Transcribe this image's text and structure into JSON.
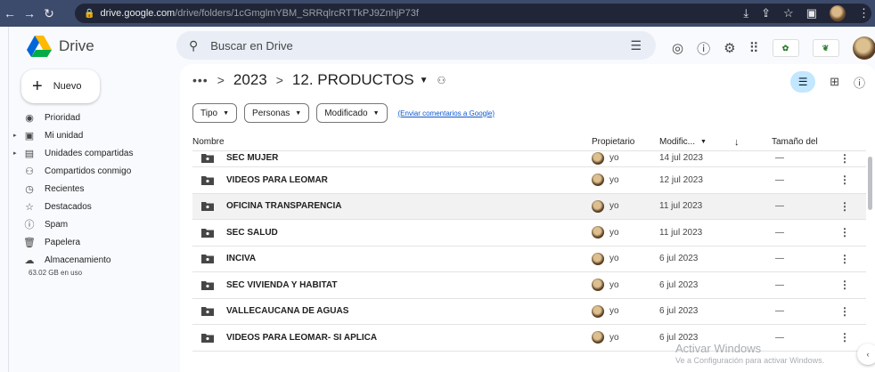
{
  "browser": {
    "url_domain": "drive.google.com",
    "url_path": "/drive/folders/1cGmglmYBM_SRRqlrcRTTkPJ9ZnhjP73f"
  },
  "app": {
    "title": "Drive",
    "search_placeholder": "Buscar en Drive",
    "new_label": "Nuevo"
  },
  "nav": {
    "items": [
      {
        "label": "Prioridad",
        "icon": "checkcircle-icon"
      },
      {
        "label": "Mi unidad",
        "icon": "drive-icon"
      },
      {
        "label": "Unidades compartidas",
        "icon": "shared-drives-icon"
      },
      {
        "label": "Compartidos conmigo",
        "icon": "people-icon"
      },
      {
        "label": "Recientes",
        "icon": "clock-icon"
      },
      {
        "label": "Destacados",
        "icon": "star-icon"
      },
      {
        "label": "Spam",
        "icon": "spam-icon"
      },
      {
        "label": "Papelera",
        "icon": "trash-icon"
      },
      {
        "label": "Almacenamiento",
        "icon": "cloud-icon"
      }
    ],
    "storage_text": "63.02 GB en uso"
  },
  "breadcrumb": {
    "more": "•••",
    "sep": ">",
    "parent": "2023",
    "current": "12. PRODUCTOS"
  },
  "filters": {
    "chips": [
      "Tipo",
      "Personas",
      "Modificado"
    ],
    "feedback": "(Enviar comentarios a Google)"
  },
  "table": {
    "headers": {
      "name": "Nombre",
      "owner": "Propietario",
      "modified": "Modific...",
      "size": "Tamaño del"
    },
    "rows": [
      {
        "name": "SEC MUJER",
        "owner": "yo",
        "date": "14 jul 2023",
        "size": "—"
      },
      {
        "name": "VIDEOS PARA LEOMAR",
        "owner": "yo",
        "date": "12 jul 2023",
        "size": "—"
      },
      {
        "name": "OFICINA TRANSPARENCIA",
        "owner": "yo",
        "date": "11 jul 2023",
        "size": "—"
      },
      {
        "name": "SEC SALUD",
        "owner": "yo",
        "date": "11 jul 2023",
        "size": "—"
      },
      {
        "name": "INCIVA",
        "owner": "yo",
        "date": "6 jul 2023",
        "size": "—"
      },
      {
        "name": "SEC VIVIENDA Y HABITAT",
        "owner": "yo",
        "date": "6 jul 2023",
        "size": "—"
      },
      {
        "name": "VALLECAUCANA DE AGUAS",
        "owner": "yo",
        "date": "6 jul 2023",
        "size": "—"
      },
      {
        "name": "VIDEOS PARA LEOMAR- SI APLICA",
        "owner": "yo",
        "date": "6 jul 2023",
        "size": "—"
      }
    ]
  },
  "watermark": {
    "line1": "Activar Windows",
    "line2": "Ve a Configuración para activar Windows."
  }
}
